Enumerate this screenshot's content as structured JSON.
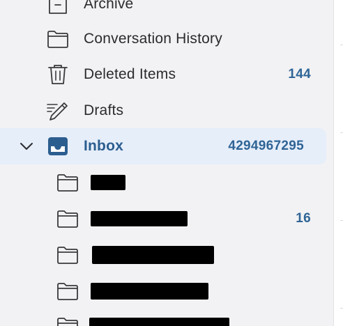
{
  "folders": [
    {
      "label": "Archive",
      "icon": "archive-icon"
    },
    {
      "label": "Conversation History",
      "icon": "folder-icon"
    },
    {
      "label": "Deleted Items",
      "count": "144",
      "icon": "trash-icon"
    },
    {
      "label": "Drafts",
      "icon": "drafts-pencil-icon"
    },
    {
      "label": "Inbox",
      "count": "4294967295",
      "icon": "inbox-tray-icon",
      "selected": true,
      "expanded": true
    }
  ],
  "inbox_subfolders": [
    {
      "redacted": true,
      "icon": "folder-icon"
    },
    {
      "redacted": true,
      "count": "16",
      "icon": "folder-icon"
    },
    {
      "redacted": true,
      "icon": "folder-icon"
    },
    {
      "redacted": true,
      "icon": "folder-icon"
    },
    {
      "redacted": true,
      "icon": "folder-icon"
    }
  ],
  "colors": {
    "sidebar_bg": "#f2f2f4",
    "selected_bg": "#e6eefa",
    "accent_text": "#2c5d8f",
    "count_text": "#2f6496",
    "icon_stroke": "#3a3a3d",
    "inbox_icon_fill": "#2c5d8f"
  }
}
